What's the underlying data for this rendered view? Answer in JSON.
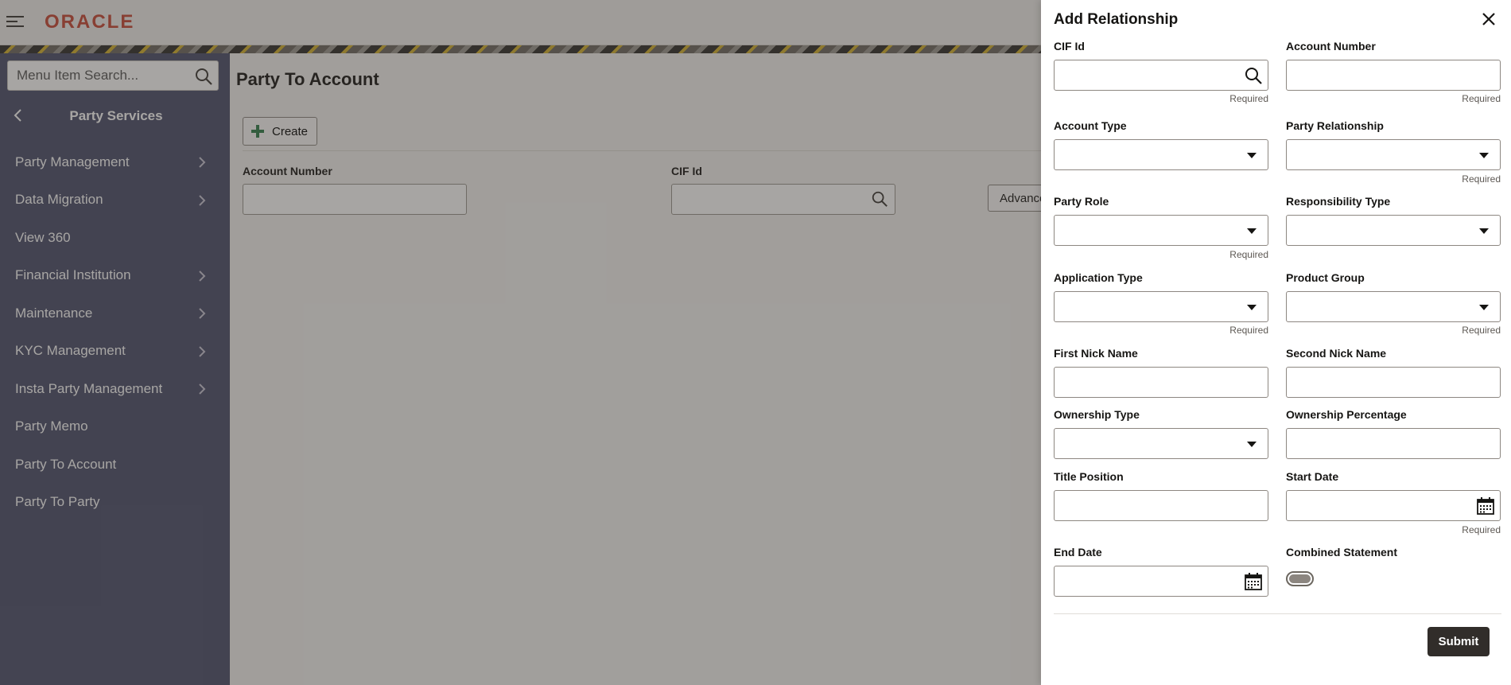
{
  "header": {
    "logo_text": "ORACLE",
    "menu_icon": "hamburger-icon"
  },
  "sidebar": {
    "search_placeholder": "Menu Item Search...",
    "section_title": "Party Services",
    "items": [
      {
        "label": "Party Management",
        "has_submenu": true
      },
      {
        "label": "Data Migration",
        "has_submenu": true
      },
      {
        "label": "View 360",
        "has_submenu": false
      },
      {
        "label": "Financial Institution",
        "has_submenu": true
      },
      {
        "label": "Maintenance",
        "has_submenu": true
      },
      {
        "label": "KYC Management",
        "has_submenu": true
      },
      {
        "label": "Insta Party Management",
        "has_submenu": true
      },
      {
        "label": "Party Memo",
        "has_submenu": false
      },
      {
        "label": "Party To Account",
        "has_submenu": false
      },
      {
        "label": "Party To Party",
        "has_submenu": false
      }
    ]
  },
  "main": {
    "page_title": "Party To Account",
    "create_label": "Create",
    "account_number_label": "Account Number",
    "cif_label": "CIF Id",
    "advanced_label": "Advanced Search"
  },
  "drawer": {
    "title": "Add Relationship",
    "required_text": "Required",
    "fields": {
      "cif_id": "CIF Id",
      "account_number": "Account Number",
      "account_type": "Account Type",
      "party_relationship": "Party Relationship",
      "party_role": "Party Role",
      "responsibility_type": "Responsibility Type",
      "application_type": "Application Type",
      "product_group": "Product Group",
      "first_nick_name": "First Nick Name",
      "second_nick_name": "Second Nick Name",
      "ownership_type": "Ownership Type",
      "ownership_percentage": "Ownership Percentage",
      "title_position": "Title Position",
      "start_date": "Start Date",
      "end_date": "End Date",
      "combined_statement": "Combined Statement"
    },
    "combined_statement_on": false,
    "submit_label": "Submit"
  },
  "colors": {
    "brand": "#c74634",
    "sidebar_bg": "#4a4e6b",
    "submit_bg": "#312d2a"
  }
}
